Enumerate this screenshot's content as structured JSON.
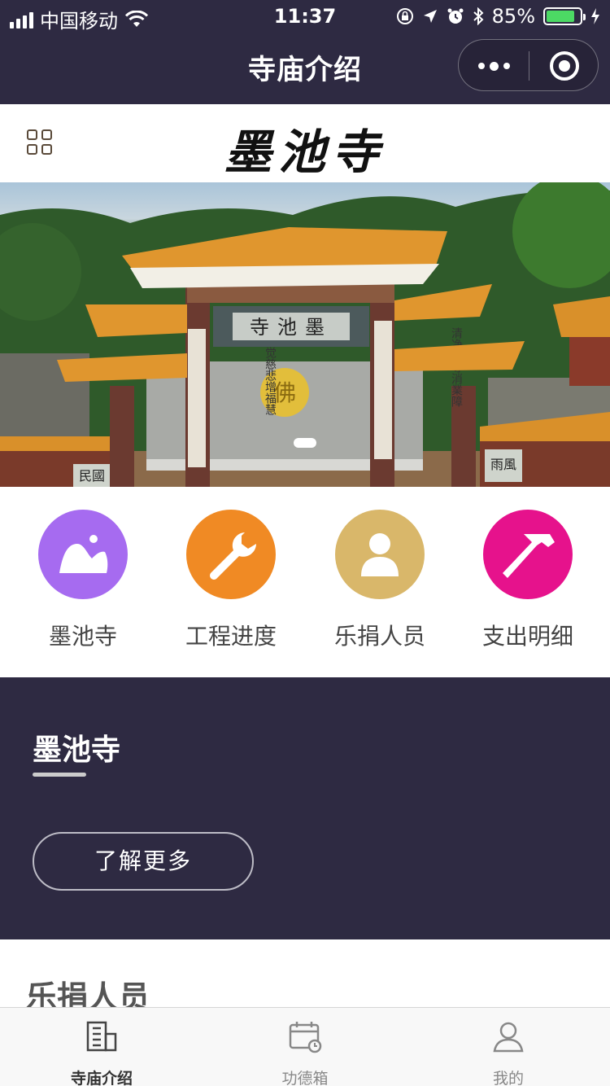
{
  "status_bar": {
    "carrier": "中国移动",
    "time": "11:37",
    "battery": "85%",
    "battery_level": 0.85
  },
  "nav": {
    "title": "寺庙介绍"
  },
  "header": {
    "logo_text": "墨池寺"
  },
  "banner": {
    "gate_plaque": "寺池墨",
    "left_couplet": "正觉慈悲增福慧",
    "right_couplet": "清净平等消業障",
    "center_emblem": "佛",
    "side_plaque_left": "民國",
    "side_plaque_right": "雨風"
  },
  "quick_links": [
    {
      "label": "墨池寺",
      "icon": "mountain-icon",
      "color": "#a66bf0"
    },
    {
      "label": "工程进度",
      "icon": "wrench-icon",
      "color": "#f08a24"
    },
    {
      "label": "乐捐人员",
      "icon": "person-icon",
      "color": "#d9b76a"
    },
    {
      "label": "支出明细",
      "icon": "hammer-icon",
      "color": "#e6128c"
    }
  ],
  "about": {
    "title": "墨池寺",
    "more_button": "了解更多"
  },
  "donors": {
    "heading": "乐捐人员"
  },
  "tabbar": [
    {
      "label": "寺庙介绍",
      "icon": "building-icon",
      "active": true
    },
    {
      "label": "功德箱",
      "icon": "calendar-clock-icon",
      "active": false
    },
    {
      "label": "我的",
      "icon": "user-icon",
      "active": false
    }
  ],
  "colors": {
    "dark_bg": "#2e2a42",
    "battery_green": "#4cd964"
  }
}
